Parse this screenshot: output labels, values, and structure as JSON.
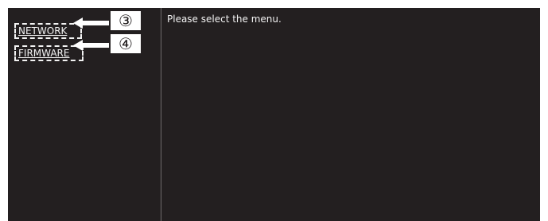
{
  "menu": {
    "items": [
      {
        "label": "NETWORK"
      },
      {
        "label": "FIRMWARE"
      }
    ]
  },
  "callouts": {
    "network": "③",
    "firmware": "④"
  },
  "content": {
    "prompt": "Please select the menu."
  },
  "colors": {
    "background": "#231f20",
    "text": "#f2f2f2",
    "divider": "#6f6b6c",
    "callout_background": "#ffffff"
  }
}
